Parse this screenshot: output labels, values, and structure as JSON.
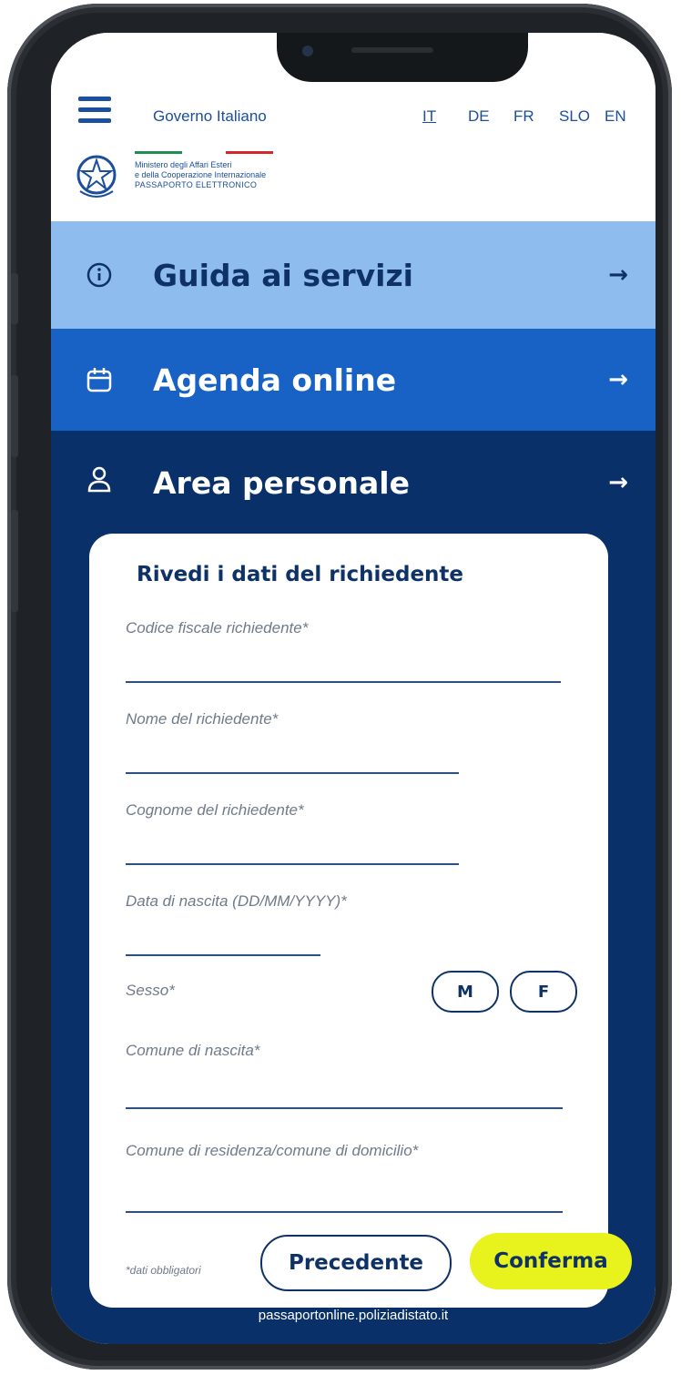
{
  "header": {
    "gov_label": "Governo Italiano",
    "languages": [
      "IT",
      "DE",
      "FR",
      "SLO",
      "EN"
    ],
    "active_language": "IT",
    "ministry_line1": "Ministero degli Affari Esteri",
    "ministry_line2": "e della Cooperazione Internazionale",
    "ministry_line3": "PASSAPORTO ELETTRONICO"
  },
  "nav": {
    "guide_label": "Guida ai servizi",
    "agenda_label": "Agenda online",
    "personal_label": "Area personale"
  },
  "form": {
    "title": "Rivedi i dati del richiedente",
    "fields": {
      "codice_fiscale": "Codice fiscale richiedente*",
      "nome": "Nome del richiedente*",
      "cognome": "Cognome del richiedente*",
      "data_nascita": "Data di nascita (DD/MM/YYYY)*",
      "sesso": "Sesso*",
      "comune_nascita": "Comune di nascita*",
      "comune_residenza": "Comune di residenza/comune di domicilio*"
    },
    "sex_options": [
      "M",
      "F"
    ],
    "required_note": "*dati obbligatori",
    "prev_button": "Precedente",
    "confirm_button": "Conferma"
  },
  "footer": {
    "url": "passaportonline.poliziadistato.it"
  },
  "colors": {
    "nav_light": "#8ebcef",
    "nav_mid": "#1762c4",
    "nav_dark": "#0a3069",
    "confirm": "#e8f21d",
    "text_dark": "#0f3266"
  }
}
